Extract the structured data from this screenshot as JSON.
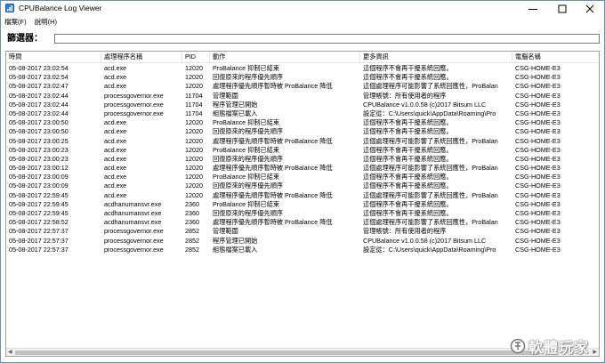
{
  "window": {
    "title": "CPUBalance Log Viewer",
    "icon": "cpubalance-app-icon"
  },
  "menu": {
    "items": [
      "檔案(F)",
      "說明(H)"
    ]
  },
  "filter": {
    "label": "篩選器：",
    "value": ""
  },
  "table": {
    "columns": [
      "時間",
      "處理程序名稱",
      "PID",
      "動作",
      "更多資訊",
      "電腦名稱"
    ],
    "rows": [
      [
        "05-08-2017 23:02:54",
        "acd.exe",
        "12020",
        "ProBalance 抑制已結束",
        "這個程序不會再干擾系統回應。",
        "CSG-HOME-E3"
      ],
      [
        "05-08-2017 23:02:54",
        "acd.exe",
        "12020",
        "回復原來的程序優先順序",
        "這個程序不會再干擾系統回應。",
        "CSG-HOME-E3"
      ],
      [
        "05-08-2017 23:02:47",
        "acd.exe",
        "12020",
        "處理程序優先順序暫時被 ProBalance 降低",
        "這個處理程序可能影響了系統回應性，ProBalan",
        "CSG-HOME-E3"
      ],
      [
        "05-08-2017 23:02:44",
        "processgovernor.exe",
        "11704",
        "管理範圍",
        "管理帳號：所有使用者的程序",
        "CSG-HOME-E3"
      ],
      [
        "05-08-2017 23:02:44",
        "processgovernor.exe",
        "11704",
        "程序管理已開始",
        "CPUBalance v1.0.0.58 (c)2017 Bitsum LLC",
        "CSG-HOME-E3"
      ],
      [
        "05-08-2017 23:02:44",
        "processgovernor.exe",
        "11704",
        "組態檔案已載入",
        "設定從：C:\\Users\\quick\\AppData\\Roaming\\Pro",
        "CSG-HOME-E3"
      ],
      [
        "05-08-2017 23:00:50",
        "acd.exe",
        "12020",
        "ProBalance 抑制已結束",
        "這個程序不會再干擾系統回應。",
        "CSG-HOME-E3"
      ],
      [
        "05-08-2017 23:00:50",
        "acd.exe",
        "12020",
        "回復原來的程序優先順序",
        "這個程序不會再干擾系統回應。",
        "CSG-HOME-E3"
      ],
      [
        "05-08-2017 23:00:25",
        "acd.exe",
        "12020",
        "處理程序優先順序暫時被 ProBalance 降低",
        "這個處理程序可能影響了系統回應性，ProBalan",
        "CSG-HOME-E3"
      ],
      [
        "05-08-2017 23:00:23",
        "acd.exe",
        "12020",
        "ProBalance 抑制已結束",
        "這個程序不會再干擾系統回應。",
        "CSG-HOME-E3"
      ],
      [
        "05-08-2017 23:00:23",
        "acd.exe",
        "12020",
        "回復原來的程序優先順序",
        "這個程序不會再干擾系統回應。",
        "CSG-HOME-E3"
      ],
      [
        "05-08-2017 23:00:12",
        "acd.exe",
        "12020",
        "處理程序優先順序暫時被 ProBalance 降低",
        "這個處理程序可能影響了系統回應性，ProBalan",
        "CSG-HOME-E3"
      ],
      [
        "05-08-2017 23:00:09",
        "acd.exe",
        "12020",
        "ProBalance 抑制已結束",
        "這個程序不會再干擾系統回應。",
        "CSG-HOME-E3"
      ],
      [
        "05-08-2017 23:00:09",
        "acd.exe",
        "12020",
        "回復原來的程序優先順序",
        "這個程序不會再干擾系統回應。",
        "CSG-HOME-E3"
      ],
      [
        "05-08-2017 22:59:45",
        "acd.exe",
        "12020",
        "處理程序優先順序暫時被 ProBalance 降低",
        "這個處理程序可能影響了系統回應性，ProBalan",
        "CSG-HOME-E3"
      ],
      [
        "05-08-2017 22:59:45",
        "acdhanumansvr.exe",
        "2360",
        "ProBalance 抑制已結束",
        "這個程序不會再干擾系統回應。",
        "CSG-HOME-E3"
      ],
      [
        "05-08-2017 22:59:45",
        "acdhanumansvr.exe",
        "2360",
        "回復原來的程序優先順序",
        "這個程序不會再干擾系統回應。",
        "CSG-HOME-E3"
      ],
      [
        "05-08-2017 22:58:52",
        "acdhanumansvr.exe",
        "2360",
        "處理程序優先順序暫時被 ProBalance 降低",
        "這個處理程序可能影響了系統回應性，ProBalan",
        "CSG-HOME-E3"
      ],
      [
        "05-08-2017 22:57:37",
        "processgovernor.exe",
        "2852",
        "管理範圍",
        "管理帳號：所有使用者的程序",
        "CSG-HOME-E3"
      ],
      [
        "05-08-2017 22:57:37",
        "processgovernor.exe",
        "2852",
        "程序管理已開始",
        "CPUBalance v1.0.0.58 (c)2017 Bitsum LLC",
        "CSG-HOME-E3"
      ],
      [
        "05-08-2017 22:57:37",
        "processgovernor.exe",
        "2852",
        "組態檔案已載入",
        "設定從：C:\\Users\\quick\\AppData\\Roaming\\Pro",
        "CSG-HOME-E3"
      ]
    ]
  },
  "watermark": {
    "text": "軟體玩家"
  },
  "colors": {
    "window_border": "#6a8fb8",
    "grid_border": "#a0a0a0",
    "scroll_thumb": "#c2c2c2"
  }
}
